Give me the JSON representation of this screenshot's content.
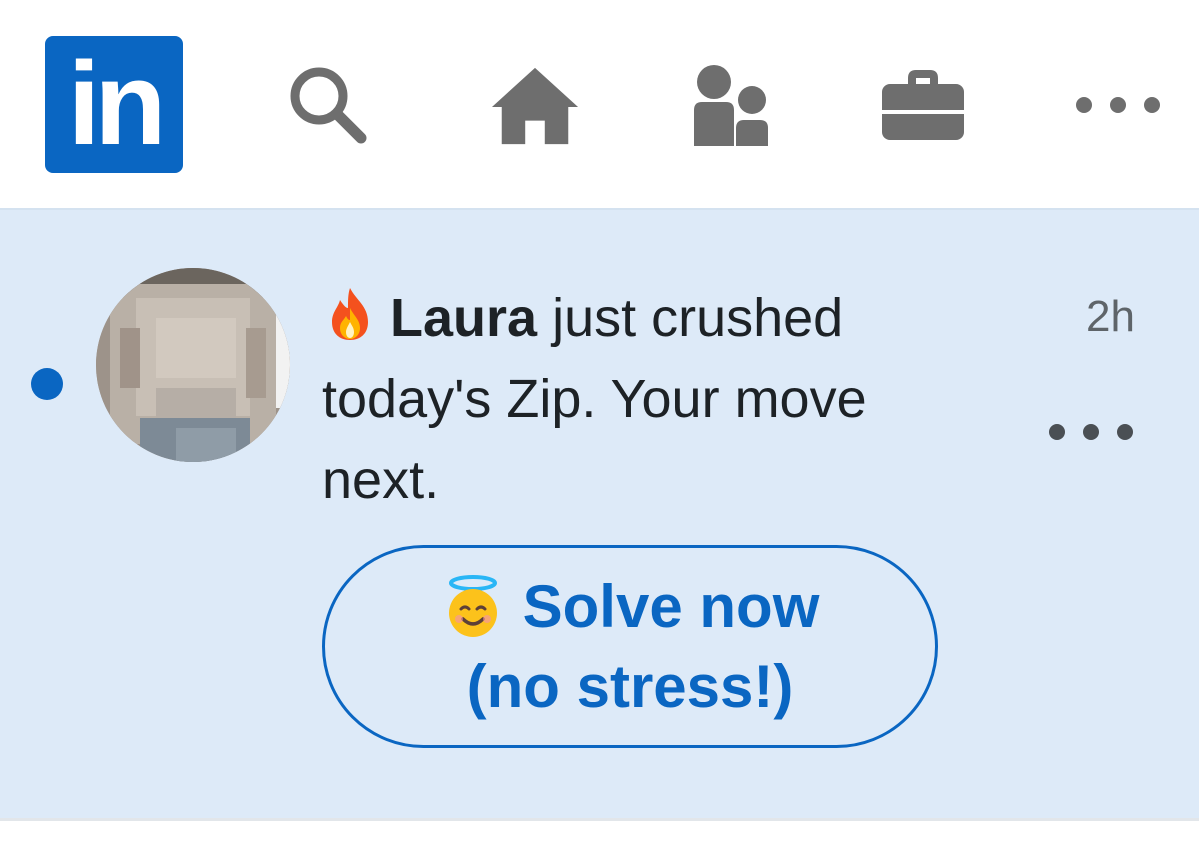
{
  "nav": {
    "logo_text": "in",
    "icons": [
      "linkedin-logo",
      "search-icon",
      "home-icon",
      "my-network-icon",
      "jobs-briefcase-icon",
      "more-icon"
    ]
  },
  "notification": {
    "emoji": "fire",
    "actor_name": "Laura",
    "message_rest": " just crushed today's Zip. Your move next.",
    "timestamp": "2h",
    "unread": true,
    "cta": {
      "emoji": "smiling-face-with-halo",
      "line1": "Solve now",
      "line2": "(no stress!)"
    }
  },
  "colors": {
    "brand_blue": "#0a66c2",
    "card_background": "#ddeaf8",
    "icon_gray": "#6e6e6e"
  }
}
